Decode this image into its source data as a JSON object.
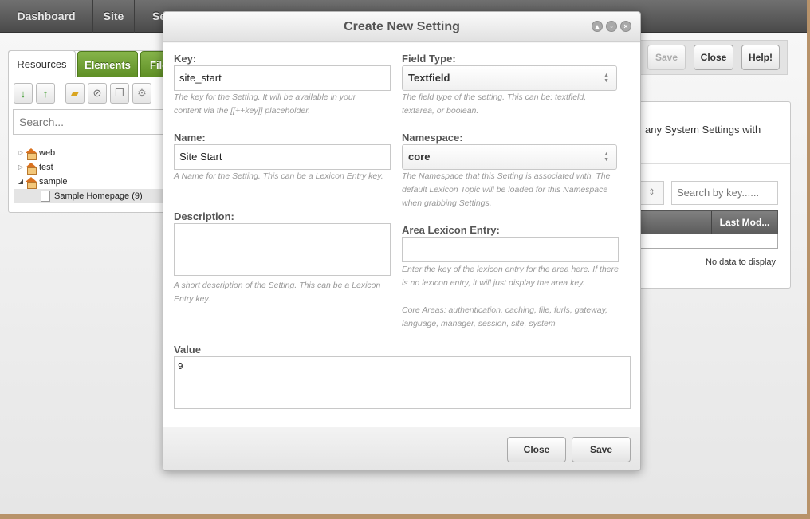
{
  "topnav": {
    "items": [
      "Dashboard",
      "Site",
      "Se"
    ]
  },
  "left": {
    "tabs": [
      "Resources",
      "Elements",
      "File"
    ],
    "search_placeholder": "Search...",
    "tree": [
      {
        "label": "web"
      },
      {
        "label": "test"
      },
      {
        "label": "sample"
      },
      {
        "label": "Sample Homepage  (9)"
      }
    ]
  },
  "right": {
    "buttons": {
      "save": "Save",
      "close": "Close",
      "help": "Help!"
    },
    "intro_text": "any System Settings with",
    "search_placeholder": "Search by key......",
    "column_header": "Last Mod...",
    "no_data": "No data to display"
  },
  "modal": {
    "title": "Create New Setting",
    "key": {
      "label": "Key:",
      "value": "site_start",
      "hint": "The key for the Setting. It will be available in your content via the [[++key]] placeholder."
    },
    "field_type": {
      "label": "Field Type:",
      "value": "Textfield",
      "hint": "The field type of the setting. This can be: textfield, textarea, or boolean."
    },
    "name": {
      "label": "Name:",
      "value": "Site Start",
      "hint": "A Name for the Setting. This can be a Lexicon Entry key."
    },
    "namespace": {
      "label": "Namespace:",
      "value": "core",
      "hint": "The Namespace that this Setting is associated with. The default Lexicon Topic will be loaded for this Namespace when grabbing Settings."
    },
    "description": {
      "label": "Description:",
      "value": "",
      "hint": "A short description of the Setting. This can be a Lexicon Entry key."
    },
    "area": {
      "label": "Area Lexicon Entry:",
      "value": "",
      "hint": "Enter the key of the lexicon entry for the area here. If there is no lexicon entry, it will just display the area key.",
      "hint2": "Core Areas: authentication, caching, file, furls, gateway, language, manager, session, site, system"
    },
    "value": {
      "label": "Value",
      "value": "9"
    },
    "buttons": {
      "close": "Close",
      "save": "Save"
    }
  },
  "colors": {
    "tab_green": "#6f9f33",
    "nav_dark": "#5a5a5a",
    "frame": "#b8936a"
  }
}
